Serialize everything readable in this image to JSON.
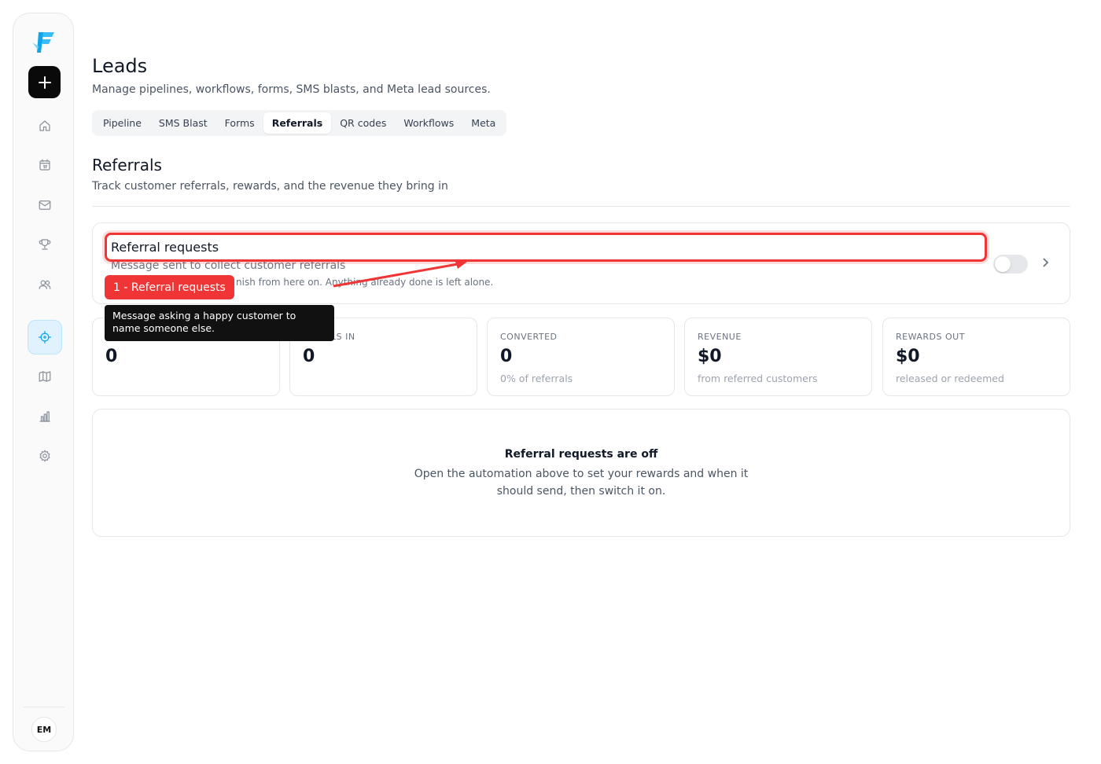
{
  "sidebar": {
    "avatar_initials": "EM",
    "nav": [
      {
        "icon": "home-icon"
      },
      {
        "icon": "calendar-icon"
      },
      {
        "icon": "mail-icon"
      },
      {
        "icon": "trophy-icon"
      },
      {
        "icon": "users-icon"
      },
      {
        "icon": "crosshair-icon",
        "active": true
      },
      {
        "icon": "map-icon"
      },
      {
        "icon": "bar-chart-icon"
      },
      {
        "icon": "gear-icon"
      }
    ]
  },
  "header": {
    "title": "Leads",
    "subtitle": "Manage pipelines, workflows, forms, SMS blasts, and Meta lead sources."
  },
  "tabs": [
    {
      "label": "Pipeline"
    },
    {
      "label": "SMS Blast"
    },
    {
      "label": "Forms"
    },
    {
      "label": "Referrals",
      "active": true
    },
    {
      "label": "QR codes"
    },
    {
      "label": "Workflows"
    },
    {
      "label": "Meta"
    }
  ],
  "section": {
    "title": "Referrals",
    "subtitle": "Track customer referrals, rewards, and the revenue they bring in"
  },
  "automation": {
    "title": "Referral requests",
    "description": "Message sent to collect customer referrals",
    "note": "nish from here on. Anything already done is left alone.",
    "enabled": false
  },
  "stats": [
    {
      "label": "",
      "value": "0",
      "hint": ""
    },
    {
      "label": "ALS IN",
      "value": "0",
      "hint": ""
    },
    {
      "label": "CONVERTED",
      "value": "0",
      "hint": "0% of referrals"
    },
    {
      "label": "REVENUE",
      "value": "$0",
      "hint": "from referred customers"
    },
    {
      "label": "REWARDS OUT",
      "value": "$0",
      "hint": "released or redeemed"
    }
  ],
  "empty_state": {
    "title": "Referral requests are off",
    "description": "Open the automation above to set your rewards and when it should send, then switch it on."
  },
  "annotation": {
    "tag": "1 - Referral requests",
    "tooltip": "Message asking a happy customer to name someone else.",
    "color": "#ef3535"
  },
  "colors": {
    "accent": "#0ea5e9",
    "primary_button": "#0a0a0a"
  }
}
